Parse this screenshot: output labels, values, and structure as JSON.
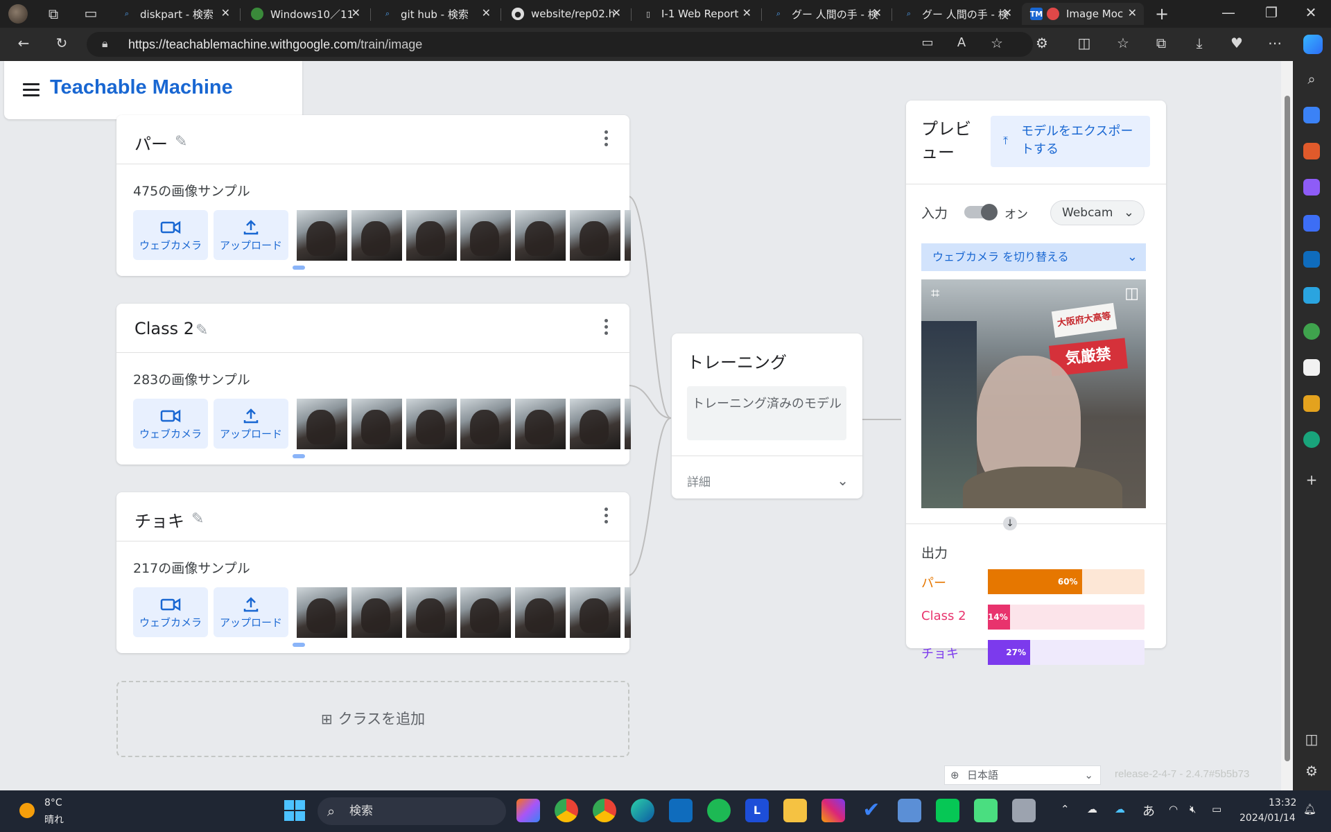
{
  "browser": {
    "tabs": [
      {
        "label": "diskpart - 検索",
        "icon": "search-icon"
      },
      {
        "label": "Windows10／11",
        "icon": "windows-icon"
      },
      {
        "label": "git hub - 検索",
        "icon": "search-icon"
      },
      {
        "label": "website/rep02.h",
        "icon": "github-icon"
      },
      {
        "label": "I-1 Web Report",
        "icon": "document-icon"
      },
      {
        "label": "グー 人間の手 - 検",
        "icon": "search-icon"
      },
      {
        "label": "グー 人間の手 - 検",
        "icon": "search-icon"
      },
      {
        "label": "Image Moc",
        "icon": "teachable-machine-icon"
      }
    ],
    "url_host": "https://teachablemachine.withgoogle.com",
    "url_path": "/train/image"
  },
  "app": {
    "title": "Teachable Machine"
  },
  "classes": [
    {
      "name": "パー",
      "count_text": "475の画像サンプル"
    },
    {
      "name": "Class 2",
      "count_text": "283の画像サンプル"
    },
    {
      "name": "チョキ",
      "count_text": "217の画像サンプル"
    }
  ],
  "sample_buttons": {
    "webcam": "ウェブカメラ",
    "upload": "アップロード"
  },
  "add_class": "クラスを追加",
  "training": {
    "title": "トレーニング",
    "button": "トレーニング済みのモデル",
    "details": "詳細"
  },
  "preview": {
    "title": "プレビュー",
    "export_button": "モデルをエクスポートする",
    "input_label": "入力",
    "toggle_state": "オン",
    "source_select": "Webcam",
    "switch_camera": "ウェブカメラ を切り替える",
    "camera_signs": [
      "大阪府大高等",
      "気厳禁"
    ],
    "output_label": "出力",
    "outputs": [
      {
        "label": "パー",
        "percent": 60,
        "percent_text": "60%",
        "color": "#e67700",
        "track": "#fde7d6"
      },
      {
        "label": "Class 2",
        "percent": 14,
        "percent_text": "14%",
        "color": "#e8336d",
        "track": "#fce4ea"
      },
      {
        "label": "チョキ",
        "percent": 27,
        "percent_text": "27%",
        "color": "#7c3aed",
        "track": "#efeafc"
      }
    ]
  },
  "footer": {
    "language": "日本語",
    "version": "release-2-4-7 - 2.4.7#5b5b73"
  },
  "taskbar": {
    "weather_temp": "8°C",
    "weather_text": "晴れ",
    "search_placeholder": "検索",
    "time": "13:32",
    "date": "2024/01/14",
    "ime": "あ"
  }
}
